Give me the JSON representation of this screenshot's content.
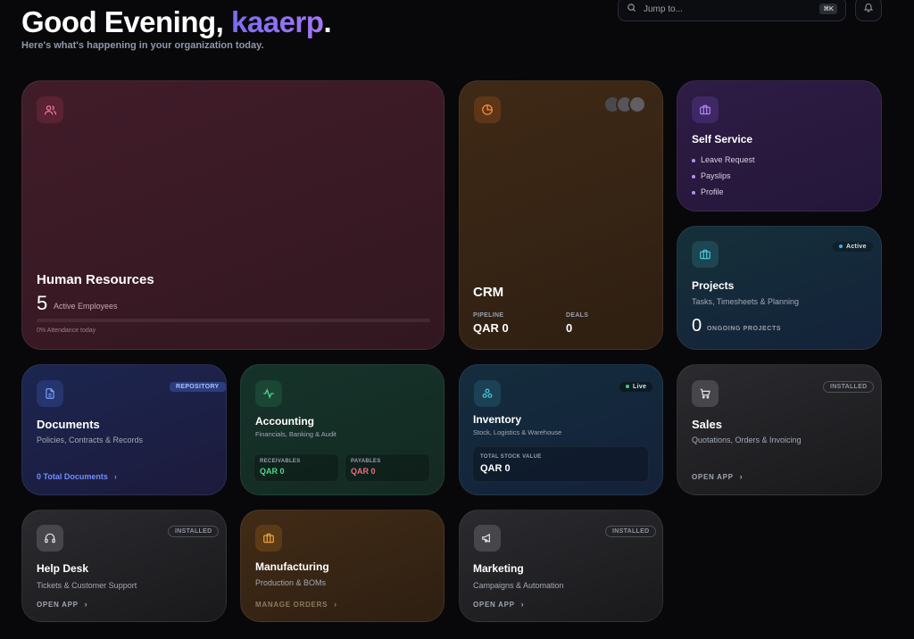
{
  "header": {
    "greeting_prefix": "Good Evening, ",
    "user_name": "kaaerp",
    "greeting_suffix": ".",
    "subtitle": "Here's what's happening in your organization today."
  },
  "search": {
    "placeholder": "Jump to...",
    "shortcut": "⌘K"
  },
  "cards": {
    "hr": {
      "title": "Human Resources",
      "count": "5",
      "count_label": "Active Employees",
      "attendance": "0% Attendance today",
      "attendance_progress": 0,
      "icon": "users-icon"
    },
    "crm": {
      "title": "CRM",
      "pipeline_label": "PIPELINE",
      "pipeline_value": "QAR 0",
      "deals_label": "DEALS",
      "deals_value": "0",
      "icon": "pie-chart-icon"
    },
    "self_service": {
      "title": "Self Service",
      "items": [
        "Leave Request",
        "Payslips",
        "Profile"
      ],
      "icon": "briefcase-icon"
    },
    "projects": {
      "title": "Projects",
      "subtitle": "Tasks, Timesheets & Planning",
      "badge": "Active",
      "count": "0",
      "count_label": "ONGOING PROJECTS",
      "icon": "briefcase-icon"
    },
    "documents": {
      "title": "Documents",
      "subtitle": "Policies, Contracts & Records",
      "badge": "REPOSITORY",
      "link": "0 Total Documents",
      "icon": "file-text-icon"
    },
    "accounting": {
      "title": "Accounting",
      "subtitle": "Financials, Banking & Audit",
      "receivables_label": "RECEIVABLES",
      "receivables_value": "QAR 0",
      "payables_label": "PAYABLES",
      "payables_value": "QAR 0",
      "icon": "activity-icon"
    },
    "inventory": {
      "title": "Inventory",
      "subtitle": "Stock, Logistics & Warehouse",
      "badge": "Live",
      "stock_label": "TOTAL STOCK VALUE",
      "stock_value": "QAR 0",
      "icon": "boxes-icon"
    },
    "sales": {
      "title": "Sales",
      "subtitle": "Quotations, Orders & Invoicing",
      "badge": "INSTALLED",
      "link": "OPEN APP",
      "icon": "cart-icon"
    },
    "helpdesk": {
      "title": "Help Desk",
      "subtitle": "Tickets & Customer Support",
      "badge": "INSTALLED",
      "link": "OPEN APP",
      "icon": "headphones-icon"
    },
    "manufacturing": {
      "title": "Manufacturing",
      "subtitle": "Production & BOMs",
      "link": "MANAGE ORDERS",
      "icon": "briefcase-icon"
    },
    "marketing": {
      "title": "Marketing",
      "subtitle": "Campaigns & Automation",
      "badge": "INSTALLED",
      "link": "OPEN APP",
      "icon": "megaphone-icon"
    }
  },
  "colors": {
    "accent": "#8b6ff2",
    "background": "#08080b",
    "positive": "#4fd78e",
    "negative": "#f36b7f"
  }
}
